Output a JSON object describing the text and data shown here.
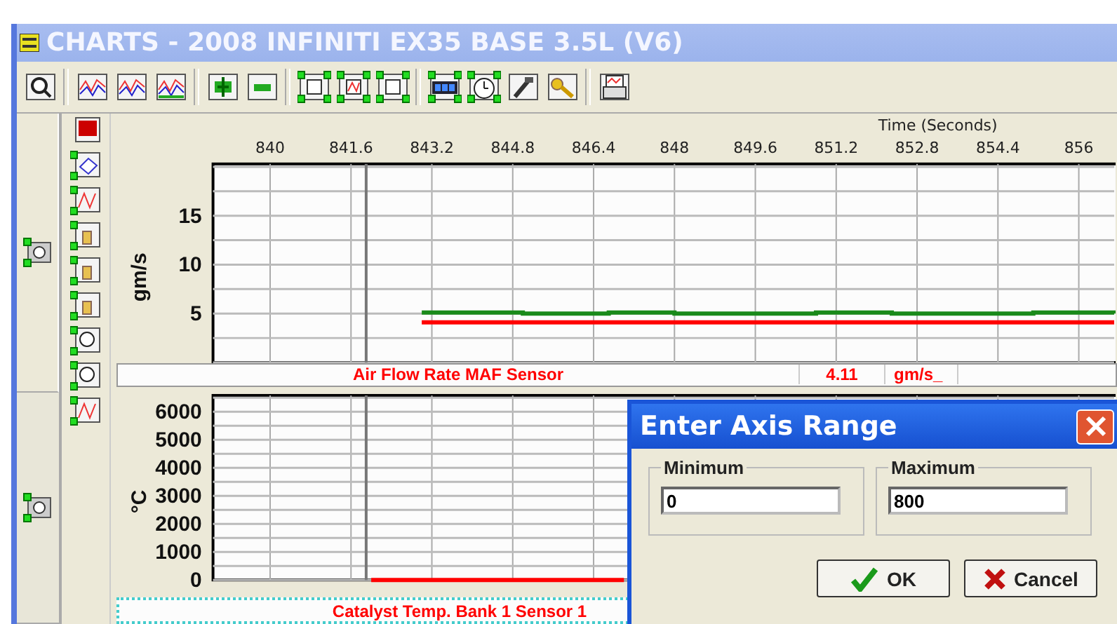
{
  "window": {
    "title": "CHARTS - 2008 INFINITI EX35 BASE 3.5L (V6)"
  },
  "side_tabs": [
    {
      "selected": true
    },
    {
      "selected": false
    }
  ],
  "charts": [
    {
      "legend": {
        "value": "4.11",
        "unit": "gm/s_"
      },
      "chart_data": {
        "type": "line",
        "grid": true,
        "ref_lines": [
          {
            "axis": "x",
            "value": 841.9
          }
        ],
        "xlabel": "Time (Seconds)",
        "ylabel": "gm/s",
        "xlim": [
          838.87,
          856.7
        ],
        "ylim": [
          0,
          20.3
        ],
        "xticks": [
          840,
          841.6,
          843.2,
          844.8,
          846.4,
          848,
          849.6,
          851.2,
          852.8,
          854.4,
          856
        ],
        "yticks": [
          5,
          10,
          15
        ],
        "x": [
          843.0,
          845.0,
          846.7,
          848.0,
          850.8,
          852.3,
          855.1,
          856.7
        ],
        "series": [
          {
            "name": "Air Flow Rate MAF Sensor",
            "color": "#1a8a1a",
            "values": [
              5.1,
              5.0,
              5.1,
              5.0,
              5.1,
              5.0,
              5.1,
              5.0
            ]
          },
          {
            "color": "#ff0000",
            "values": [
              4.1,
              4.1,
              4.1,
              4.1,
              4.1,
              4.1,
              4.1,
              4.1
            ]
          }
        ]
      }
    },
    {
      "chart_data": {
        "type": "line",
        "grid": true,
        "ref_lines": [
          {
            "axis": "x",
            "value": 841.9
          }
        ],
        "ylabel": "°C",
        "xlim": [
          838.87,
          856.7
        ],
        "ylim": [
          0,
          6580
        ],
        "yticks": [
          0,
          1000,
          2000,
          3000,
          4000,
          5000,
          6000
        ],
        "x": [
          842.0,
          847.0
        ],
        "series": [
          {
            "name": "Catalyst Temp. Bank 1 Sensor 1",
            "color": "#ff0000",
            "values": [
              0,
              0
            ]
          }
        ]
      }
    }
  ],
  "dialog": {
    "title": "Enter Axis Range",
    "groups": [
      {
        "label": "Minimum",
        "value": "0"
      },
      {
        "label": "Maximum",
        "value": "800"
      }
    ],
    "buttons": [
      {
        "label": "OK",
        "kind": "ok"
      },
      {
        "label": "Cancel",
        "kind": "cancel"
      }
    ]
  }
}
